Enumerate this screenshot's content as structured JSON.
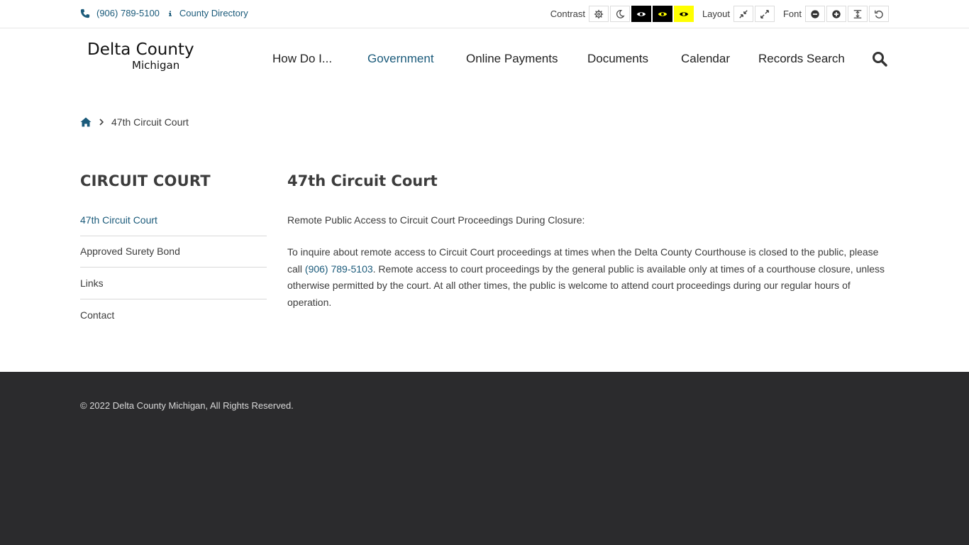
{
  "topbar": {
    "phone": "(906) 789-5100",
    "directory": "County Directory",
    "contrast_label": "Contrast",
    "layout_label": "Layout",
    "font_label": "Font"
  },
  "logo": {
    "line1": "Delta County",
    "line2": "Michigan"
  },
  "nav": {
    "items": [
      "How Do I...",
      "Government",
      "Online Payments",
      "Documents",
      "Calendar",
      "Records Search"
    ]
  },
  "breadcrumb": {
    "current": "47th Circuit Court"
  },
  "sidebar": {
    "title": "CIRCUIT COURT",
    "items": [
      "47th Circuit Court",
      "Approved Surety Bond",
      "Links",
      "Contact"
    ]
  },
  "main": {
    "title": "47th Circuit Court",
    "intro": "Remote Public Access to Circuit Court Proceedings During Closure:",
    "body_before": "To inquire about remote access to Circuit Court proceedings at times when the Delta County Courthouse is closed to the public, please call ",
    "body_phone": "(906) 789-5103",
    "body_after": ". Remote access to court proceedings by the general public is available only at times of a courthouse closure, unless otherwise permitted by the court.  At all other times, the public is welcome to attend court proceedings during our regular hours of operation."
  },
  "footer": {
    "copyright": "© 2022 Delta County Michigan, All Rights Reserved."
  },
  "colors": {
    "link": "#1a5a7a",
    "footer_bg": "#2b2b2d",
    "high_contrast_yellow": "#ffff00"
  }
}
